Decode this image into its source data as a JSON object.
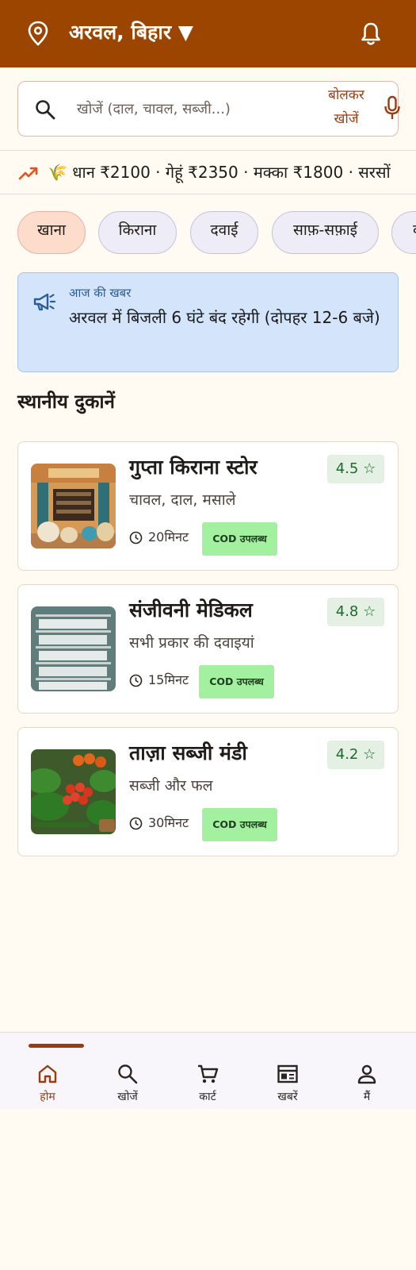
{
  "header": {
    "location": "अरवल, बिहार ▼",
    "location_icon": "location-pin-icon",
    "bell_icon": "bell-icon",
    "color": "#9c4500"
  },
  "search": {
    "placeholder": "खोजें (दाल, चावल, सब्जी...)",
    "value": "",
    "voice_label": "बोलकर खोजें",
    "icon": "search-icon",
    "mic_icon": "mic-icon"
  },
  "ticker": {
    "icon": "trending-up-icon",
    "text": "🌾 धान ₹2100 · गेहूं ₹2350 · मक्का ₹1800 · सरसों"
  },
  "categories": [
    {
      "label": "खाना",
      "active": true
    },
    {
      "label": "किराना",
      "active": false
    },
    {
      "label": "दवाई",
      "active": false
    },
    {
      "label": "साफ़-सफ़ाई",
      "active": false
    },
    {
      "label": "व",
      "active": false
    }
  ],
  "news": {
    "icon": "megaphone-icon",
    "title": "आज की खबर",
    "body": "अरवल में बिजली 6 घंटे बंद रहेगी (दोपहर 12-6 बजे)"
  },
  "section_title": "स्थानीय दुकानें",
  "shops": [
    {
      "name": "गुप्ता किराना स्टोर",
      "desc": "चावल, दाल, मसाले",
      "rating": "4.5 ☆",
      "time": "20मिनट",
      "cod": "COD उपलब्ध",
      "image": "grocery-store-image"
    },
    {
      "name": "संजीवनी मेडिकल",
      "desc": "सभी प्रकार की दवाइयां",
      "rating": "4.8 ☆",
      "time": "15मिनट",
      "cod": "COD उपलब्ध",
      "image": "medical-shelves-image"
    },
    {
      "name": "ताज़ा सब्जी मंडी",
      "desc": "सब्जी और फल",
      "rating": "4.2 ☆",
      "time": "30मिनट",
      "cod": "COD उपलब्ध",
      "image": "vegetables-image"
    }
  ],
  "nav": [
    {
      "label": "होम",
      "icon": "home-icon",
      "active": true
    },
    {
      "label": "खोजें",
      "icon": "search-icon",
      "active": false
    },
    {
      "label": "कार्ट",
      "icon": "cart-icon",
      "active": false
    },
    {
      "label": "खबरें",
      "icon": "news-icon",
      "active": false
    },
    {
      "label": "मैं",
      "icon": "profile-icon",
      "active": false
    }
  ],
  "colors": {
    "accent": "#9c3b10",
    "rating_bg": "#e5f0e4",
    "rating_text": "#1d6b2a",
    "cod_bg": "#a3f0a1",
    "news_bg": "#d3e4fb"
  }
}
